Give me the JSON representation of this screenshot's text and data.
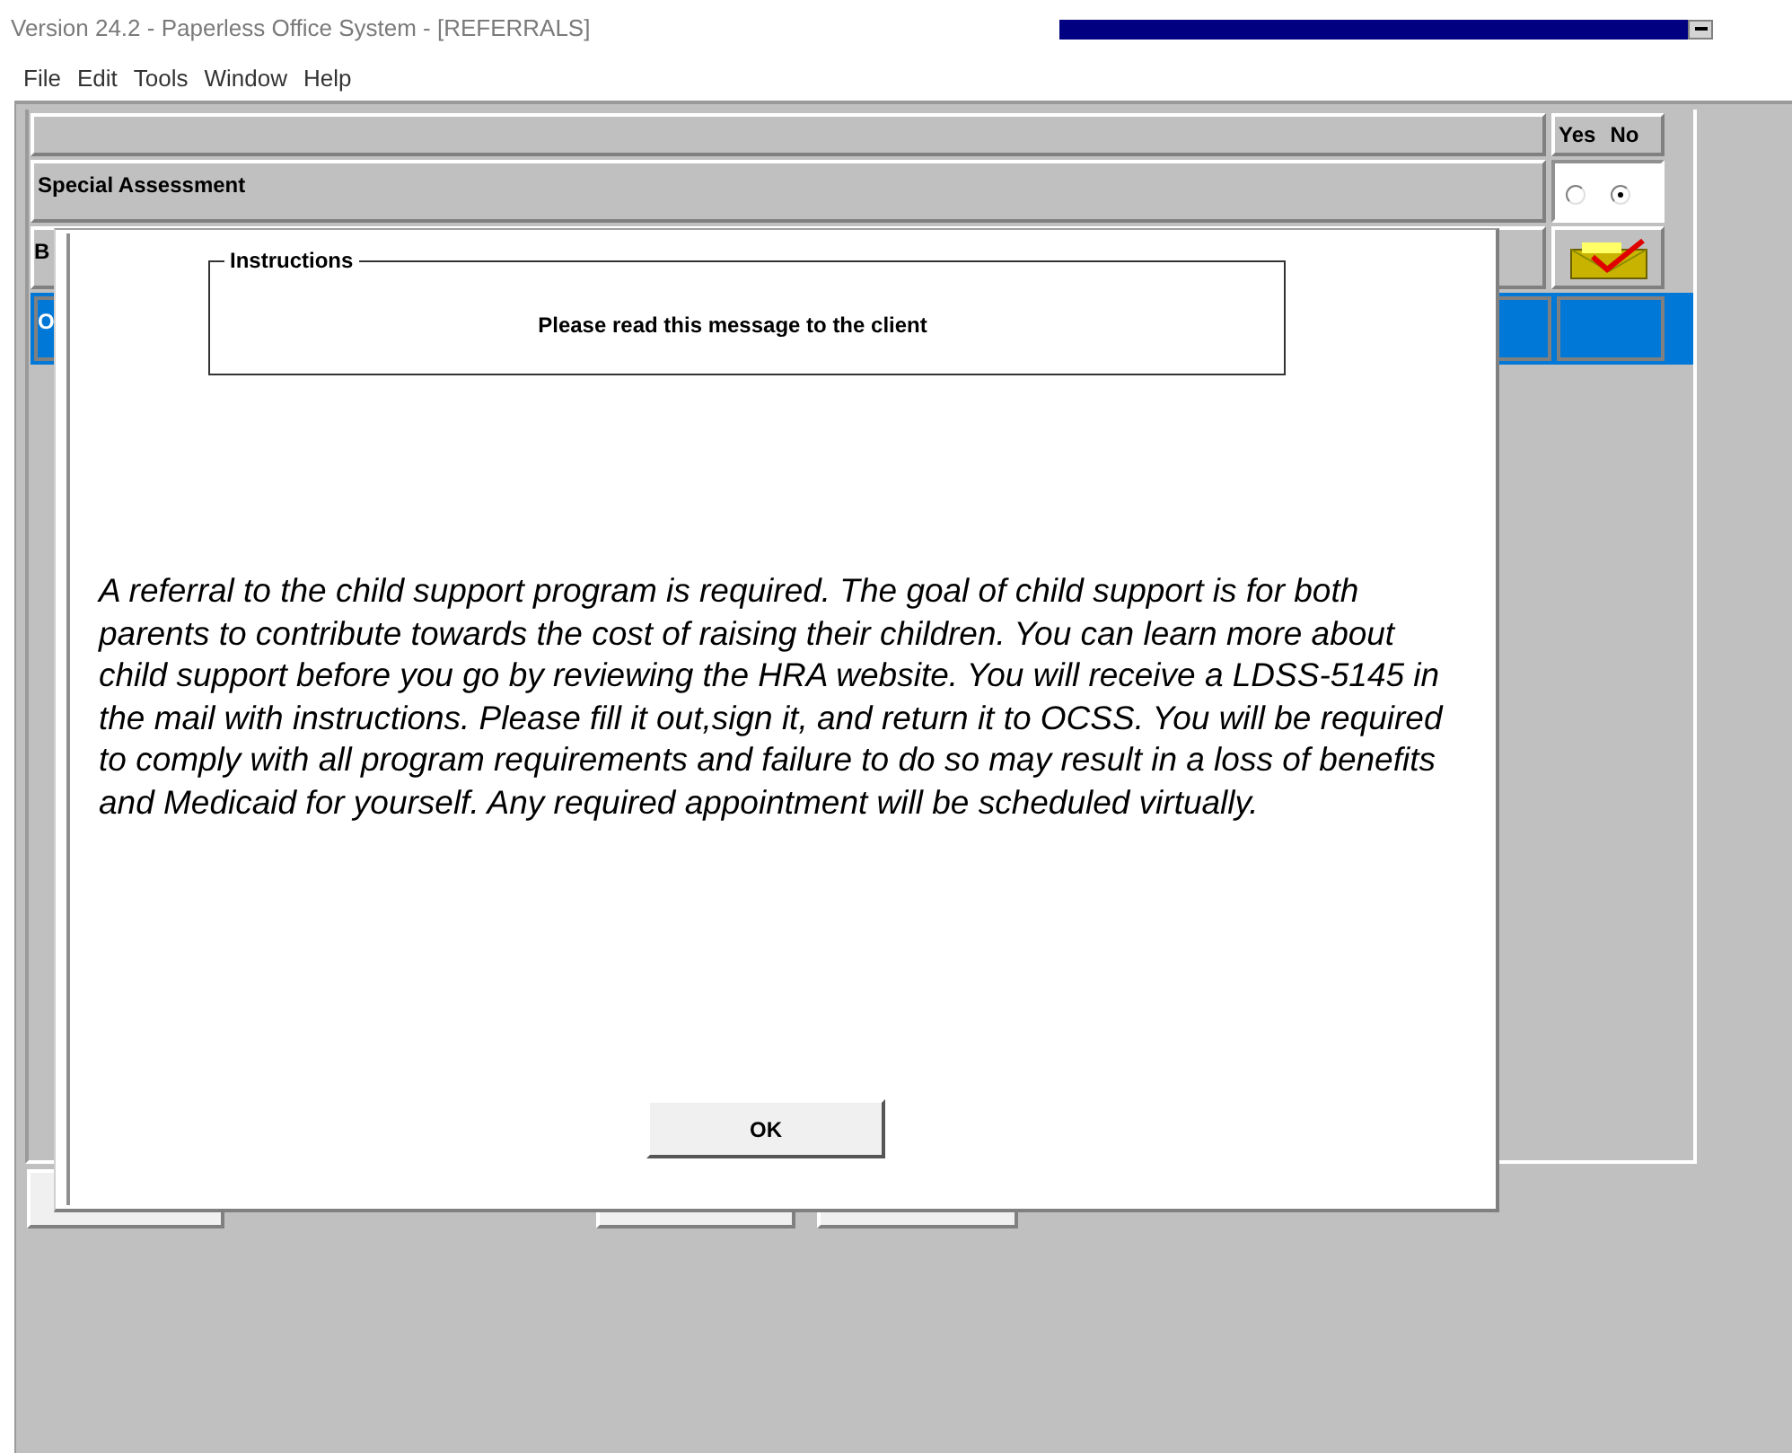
{
  "window": {
    "title": "Version 24.2 - Paperless Office System - [REFERRALS]"
  },
  "menu": [
    "File",
    "Edit",
    "Tools",
    "Window",
    "Help"
  ],
  "grid": {
    "answer_header": [
      "Yes",
      "No"
    ],
    "rows": [
      {
        "label": "Special Assessment",
        "options": [
          {
            "selected": false
          },
          {
            "selected": true
          }
        ]
      },
      {
        "label": "B"
      },
      {
        "label": "O",
        "selected": true
      }
    ]
  },
  "dialog": {
    "group_title": "Instructions",
    "heading": "Please read this message to the client",
    "message": "A referral to the child support program is required. The goal of child support is for both parents to contribute towards the cost of raising their children. You can learn more about child support before you go by reviewing the HRA website. You will receive a LDSS-5145 in the mail with instructions. Please fill it out,sign it, and return it to OCSS. You will be required to comply with all program requirements and failure to do so may result in a loss of benefits and Medicaid for yourself. Any required appointment will be scheduled virtually.",
    "button": "OK"
  }
}
